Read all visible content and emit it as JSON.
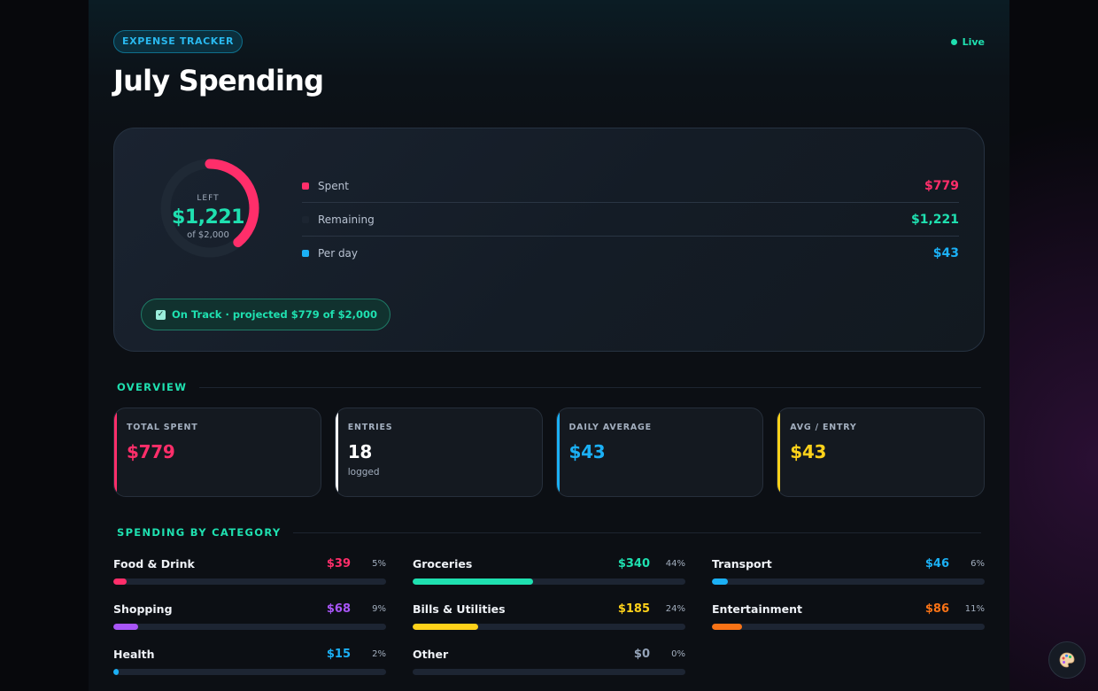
{
  "header": {
    "tag": "EXPENSE TRACKER",
    "live": "Live",
    "title": "July Spending"
  },
  "summary": {
    "donut_label": "LEFT",
    "donut_value": "$1,221",
    "donut_sub": "of $2,000",
    "spent_fraction": 0.3895,
    "stats": [
      {
        "label": "Spent",
        "value": "$779",
        "color": "#ff2e6a"
      },
      {
        "label": "Remaining",
        "value": "$1,221",
        "color": "#1fe0b0"
      },
      {
        "label": "Per day",
        "value": "$43",
        "color": "#1bb0f5"
      }
    ],
    "status": "On Track · projected $779 of $2,000"
  },
  "overview": {
    "title": "OVERVIEW",
    "cards": [
      {
        "label": "TOTAL SPENT",
        "value": "$779",
        "sub": "",
        "color": "#ff2e6a"
      },
      {
        "label": "ENTRIES",
        "value": "18",
        "sub": "logged",
        "color": "#ffffff"
      },
      {
        "label": "DAILY AVERAGE",
        "value": "$43",
        "sub": "",
        "color": "#1bb0f5"
      },
      {
        "label": "AVG / ENTRY",
        "value": "$43",
        "sub": "",
        "color": "#ffd21a"
      }
    ]
  },
  "categories": {
    "title": "SPENDING BY CATEGORY",
    "items": [
      {
        "name": "Food & Drink",
        "amount": "$39",
        "pct": "5%",
        "fraction": 0.05,
        "color": "#ff2e6a"
      },
      {
        "name": "Groceries",
        "amount": "$340",
        "pct": "44%",
        "fraction": 0.44,
        "color": "#1fe0b0"
      },
      {
        "name": "Transport",
        "amount": "$46",
        "pct": "6%",
        "fraction": 0.06,
        "color": "#1bb0f5"
      },
      {
        "name": "Shopping",
        "amount": "$68",
        "pct": "9%",
        "fraction": 0.09,
        "color": "#a855f7"
      },
      {
        "name": "Bills & Utilities",
        "amount": "$185",
        "pct": "24%",
        "fraction": 0.24,
        "color": "#ffd21a"
      },
      {
        "name": "Entertainment",
        "amount": "$86",
        "pct": "11%",
        "fraction": 0.11,
        "color": "#f97316"
      },
      {
        "name": "Health",
        "amount": "$15",
        "pct": "2%",
        "fraction": 0.02,
        "color": "#1bb0f5"
      },
      {
        "name": "Other",
        "amount": "$0",
        "pct": "0%",
        "fraction": 0.0,
        "color": "#94a3b8"
      }
    ]
  },
  "icons": {
    "palette": "palette-icon",
    "check": "checkbox-icon",
    "live": "live-dot-icon"
  }
}
